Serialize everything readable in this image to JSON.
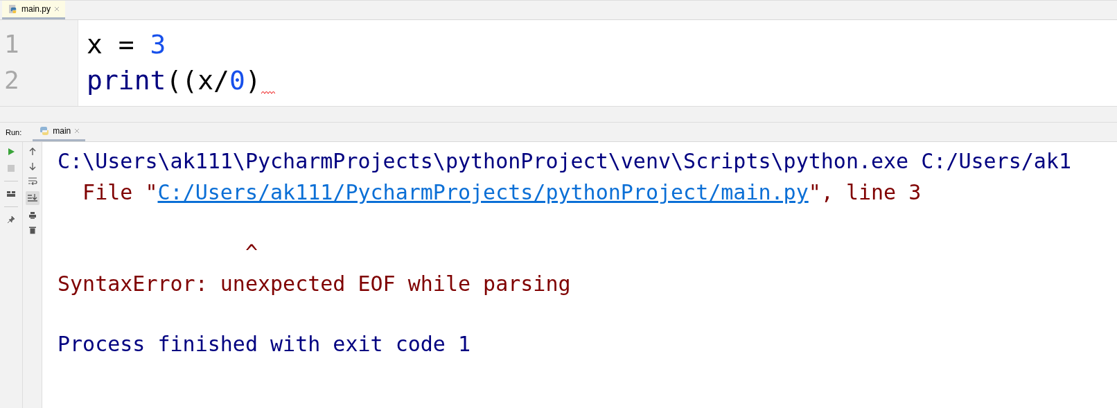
{
  "editor_tabs": [
    {
      "label": "main.py",
      "selected": true
    }
  ],
  "code_lines": [
    {
      "number": "1",
      "tokens": [
        {
          "kind": "name",
          "text": "x = "
        },
        {
          "kind": "number",
          "text": "3"
        }
      ],
      "error": false
    },
    {
      "number": "2",
      "tokens": [
        {
          "kind": "builtin",
          "text": "print"
        },
        {
          "kind": "name",
          "text": "((x/"
        },
        {
          "kind": "number",
          "text": "0"
        },
        {
          "kind": "name",
          "text": ")"
        }
      ],
      "error": true
    }
  ],
  "run_panel": {
    "label": "Run:",
    "tabs": [
      {
        "label": "main",
        "selected": true
      }
    ]
  },
  "console_lines": [
    {
      "segments": [
        {
          "kind": "plain",
          "text": "C:\\Users\\ak111\\PycharmProjects\\pythonProject\\venv\\Scripts\\python.exe C:/Users/ak1"
        }
      ]
    },
    {
      "segments": [
        {
          "kind": "error",
          "text": "  File \""
        },
        {
          "kind": "link",
          "text": "C:/Users/ak111/PycharmProjects/pythonProject/main.py"
        },
        {
          "kind": "error",
          "text": "\", line 3"
        }
      ]
    },
    {
      "kind": "blank"
    },
    {
      "segments": [
        {
          "kind": "error",
          "text": "               ^"
        }
      ]
    },
    {
      "segments": [
        {
          "kind": "error",
          "text": "SyntaxError: unexpected EOF while parsing"
        }
      ]
    },
    {
      "kind": "blank"
    },
    {
      "segments": [
        {
          "kind": "plain",
          "text": "Process finished with exit code 1"
        }
      ]
    }
  ]
}
